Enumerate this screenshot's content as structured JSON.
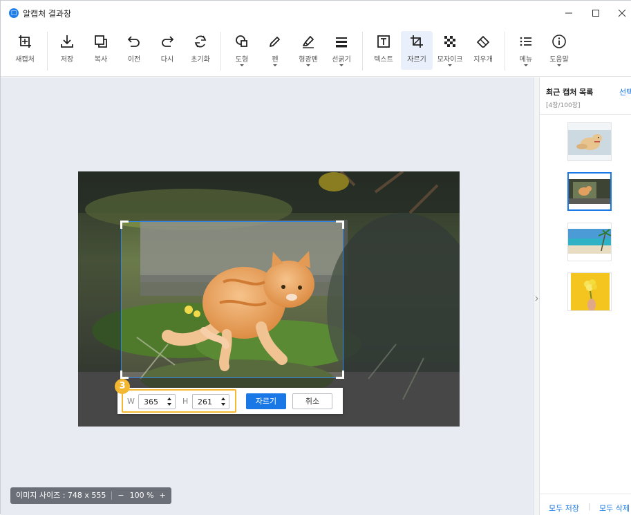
{
  "window": {
    "title": "알캡처 결과창",
    "logo_glyph": "□"
  },
  "toolbar": {
    "new_capture": "새캡처",
    "save": "저장",
    "copy": "복사",
    "undo": "이전",
    "redo": "다시",
    "reset": "초기화",
    "shape": "도형",
    "pen": "펜",
    "highlighter": "형광펜",
    "line_width": "선굵기",
    "text": "텍스트",
    "crop": "자르기",
    "mosaic": "모자이크",
    "eraser": "지우개",
    "menu": "메뉴",
    "help": "도움말",
    "active_tool": "crop"
  },
  "crop": {
    "step_badge": "3",
    "w_label": "W",
    "w_value": "365",
    "h_label": "H",
    "h_value": "261",
    "apply_label": "자르기",
    "cancel_label": "취소"
  },
  "status": {
    "image_size": "이미지 사이즈 : 748 x 555",
    "zoom_out": "−",
    "zoom_value": "100 %",
    "zoom_in": "+"
  },
  "panel": {
    "title": "최근 캡처 목록",
    "select_label": "선택",
    "count": "[4장/100장]",
    "thumbnails": [
      "dog-thumbnail",
      "cat-thumbnail",
      "beach-thumbnail",
      "flowers-thumbnail"
    ],
    "selected_index": 1,
    "save_all": "모두 저장",
    "delete_all": "모두 삭제"
  },
  "colors": {
    "accent": "#1a78e6",
    "badge": "#f4b731",
    "canvas_bg": "#e8ebf2"
  }
}
